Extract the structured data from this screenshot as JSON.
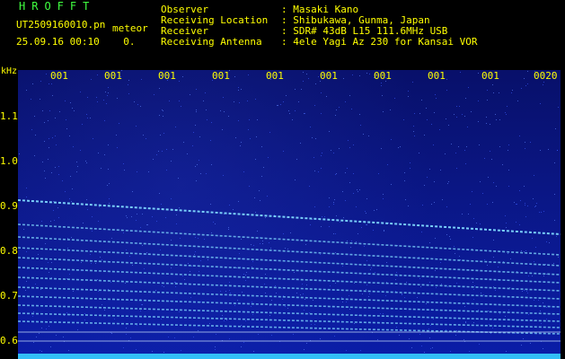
{
  "header": {
    "app_title": "HROFFT",
    "file_name": "UT2509160010.pn",
    "meteor_tag": "meteor",
    "date_time": "25.09.16 00:10    0.",
    "info_labels": "Observer\nReceiving Location\nReceiver\nReceiving Antenna",
    "info_values": ": Masaki Kano\n: Shibukawa, Gunma, Japan\n: SDR# 43dB L15 111.6MHz USB\n: 4ele Yagi Az 230 for Kansai VOR"
  },
  "axis": {
    "freq_unit": "kHz",
    "freq_ticks": [
      "1.1",
      "1.0",
      "0.9",
      "0.8",
      "0.7",
      "0.6"
    ],
    "time_ticks": [
      "001",
      "001",
      "001",
      "001",
      "001",
      "001",
      "001",
      "001",
      "001",
      "0020"
    ]
  },
  "colors": {
    "background": "#000000",
    "text": "#ffff00",
    "title": "#40ff40",
    "spectrogram": "#0b1990",
    "trace": "#7fd8ff"
  }
}
